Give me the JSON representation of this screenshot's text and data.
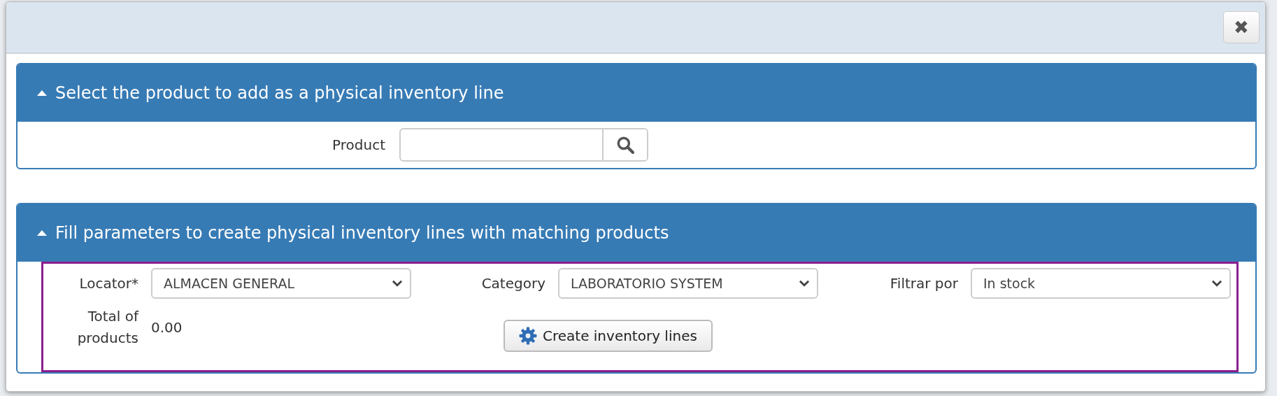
{
  "dialog": {
    "close_label": "✖"
  },
  "panels": [
    {
      "title": "Select the product to add as a physical inventory line",
      "expanded": true,
      "kind": "search",
      "field": {
        "label": "Product"
      }
    },
    {
      "title": "Fill parameters to create physical inventory lines with matching products",
      "expanded": true,
      "kind": "params",
      "selects": [
        {
          "label": "Locator*",
          "value": "ALMACEN GENERAL"
        },
        {
          "label": "Category",
          "value": "LABORATORIO SYSTEM"
        },
        {
          "label": "Filtrar por",
          "value": "In stock"
        }
      ],
      "total": {
        "label": "Total of products",
        "value": "0.00"
      },
      "button": "Create inventory lines"
    }
  ]
}
